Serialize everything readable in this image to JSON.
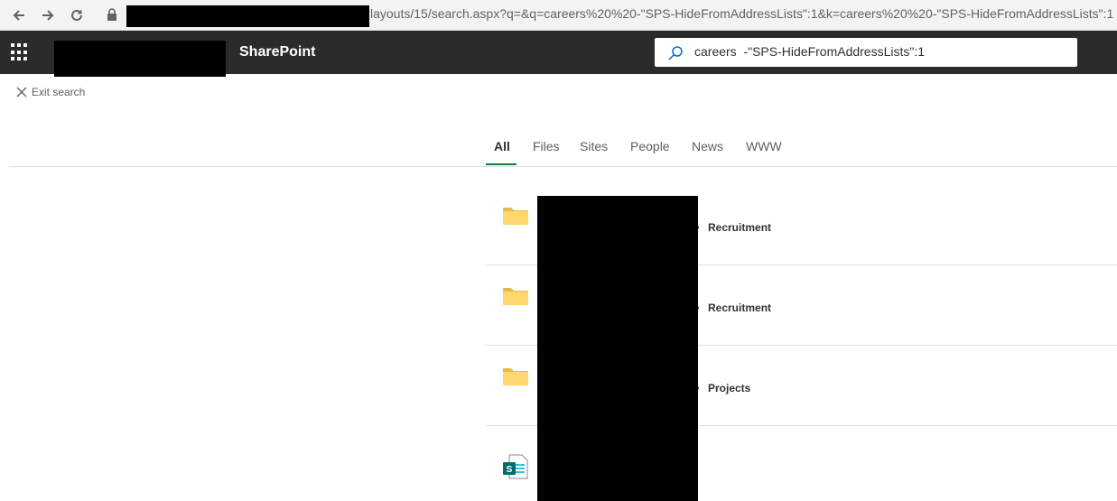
{
  "browser": {
    "url_visible": "layouts/15/search.aspx?q=&q=careers%20%20-\"SPS-HideFromAddressLists\":1&k=careers%20%20-\"SPS-HideFromAddressLists\":1",
    "icons": [
      "back-arrow-icon",
      "forward-arrow-icon",
      "reload-icon",
      "lock-icon"
    ]
  },
  "header": {
    "app_title": "SharePoint",
    "search_value": "careers  -\"SPS-HideFromAddressLists\":1",
    "icons": [
      "app-launcher-icon",
      "search-icon"
    ]
  },
  "exit_search": {
    "label": "Exit search",
    "icon": "close-icon"
  },
  "tabs": [
    {
      "label": "All",
      "active": true
    },
    {
      "label": "Files",
      "active": false
    },
    {
      "label": "Sites",
      "active": false
    },
    {
      "label": "People",
      "active": false
    },
    {
      "label": "News",
      "active": false
    },
    {
      "label": "WWW",
      "active": false
    }
  ],
  "results": [
    {
      "icon": "folder-icon",
      "location": "Recruitment"
    },
    {
      "icon": "folder-icon",
      "location": "Recruitment"
    },
    {
      "icon": "folder-icon",
      "location": "Projects"
    },
    {
      "icon": "sharepoint-page-icon",
      "location": ""
    }
  ],
  "colors": {
    "suite_bar": "#2b2b2b",
    "tab_accent": "#107c41",
    "folder": "#ffd76e",
    "folder_tab": "#e9b949",
    "sharepoint_teal": "#036c70"
  }
}
